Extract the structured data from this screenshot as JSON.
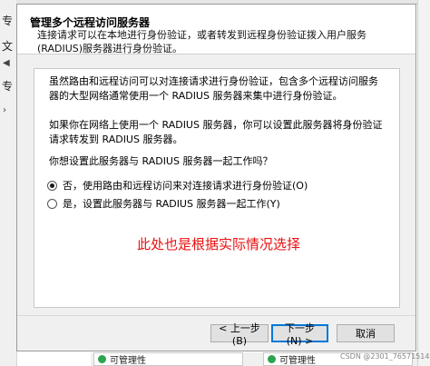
{
  "background": {
    "left_chars": [
      "专",
      "文",
      "专"
    ],
    "right_char": ""
  },
  "dialog": {
    "title": "管理多个远程访问服务器",
    "subtitle": "连接请求可以在本地进行身份验证，或者转发到远程身份验证拨入用户服务(RADIUS)服务器进行身份验证。",
    "para1": "虽然路由和远程访问可以对连接请求进行身份验证，包含多个远程访问服务器的大型网络通常使用一个 RADIUS 服务器来集中进行身份验证。",
    "para2": "如果你在网络上使用一个 RADIUS 服务器，你可以设置此服务器将身份验证请求转发到 RADIUS 服务器。",
    "question": "你想设置此服务器与 RADIUS 服务器一起工作吗？",
    "options": [
      {
        "label": "否，使用路由和远程访问来对连接请求进行身份验证(O)",
        "selected": true
      },
      {
        "label": "是，设置此服务器与 RADIUS 服务器一起工作(Y)",
        "selected": false
      }
    ],
    "annotation": "此处也是根据实际情况选择",
    "buttons": {
      "prev": "< 上一步(B)",
      "next": "下一步(N) >",
      "cancel": "取消"
    }
  },
  "taskbar": {
    "tile1": "可管理性",
    "tile2": "可管理性"
  },
  "watermark": "CSDN @2301_76571514",
  "colors": {
    "annotation": "#e81010",
    "focus_border": "#0078d7",
    "status_green": "#2da44e"
  }
}
